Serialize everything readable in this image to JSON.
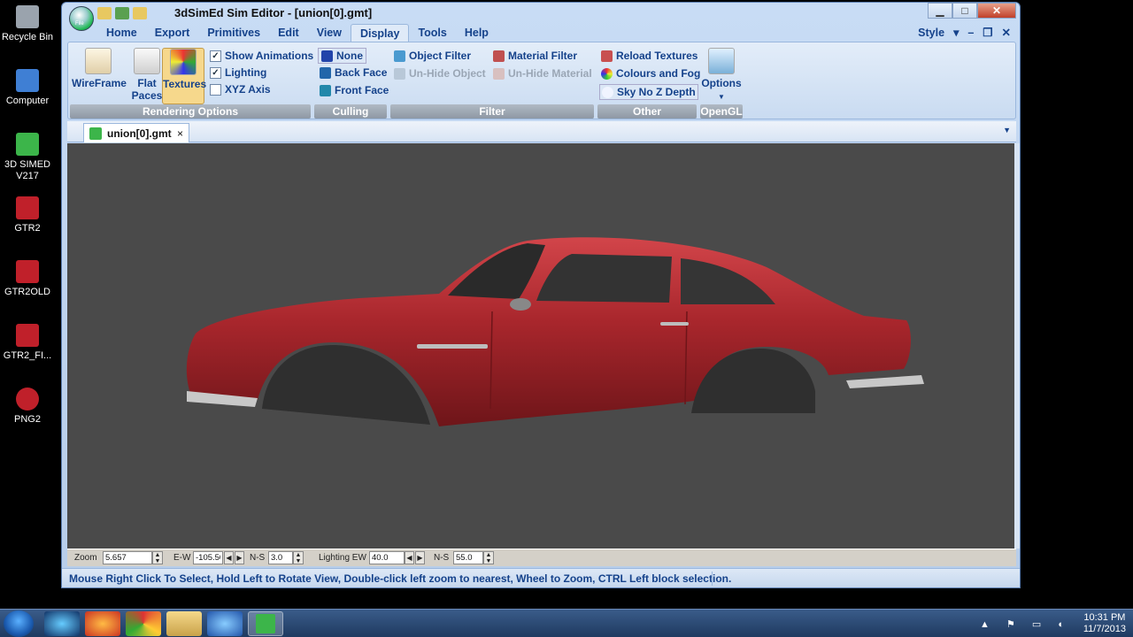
{
  "desktop": {
    "icons": [
      {
        "label": "Recycle Bin",
        "color": "#9aa3ad"
      },
      {
        "label": "Computer",
        "color": "#3f7fd4"
      },
      {
        "label": "3D SIMED V217",
        "color": "#3cb54a"
      },
      {
        "label": "GTR2",
        "color": "#c0202a"
      },
      {
        "label": "GTR2OLD",
        "color": "#c0202a"
      },
      {
        "label": "GTR2_FI...",
        "color": "#c0202a"
      },
      {
        "label": "PNG2",
        "color": "#c0202a"
      }
    ]
  },
  "window": {
    "title": "3dSimEd Sim Editor - [union[0].gmt]",
    "orb_label": "File",
    "controls": {
      "minimize": "▁",
      "maximize": "□",
      "close": "✕"
    }
  },
  "menu": {
    "items": [
      "Home",
      "Export",
      "Primitives",
      "Edit",
      "View",
      "Display",
      "Tools",
      "Help"
    ],
    "active": "Display",
    "style_label": "Style"
  },
  "ribbon": {
    "rendering": {
      "label": "Rendering Options",
      "wireframe": "WireFrame",
      "flat_faces_1": "Flat",
      "flat_faces_2": "Paces",
      "textures": "Textures",
      "show_animations": "Show Animations",
      "lighting": "Lighting",
      "xyz_axis": "XYZ Axis",
      "show_animations_checked": true,
      "lighting_checked": true,
      "xyz_axis_checked": false
    },
    "culling": {
      "label": "Culling",
      "none": "None",
      "back_face": "Back Face",
      "front_face": "Front Face"
    },
    "filter": {
      "label": "Filter",
      "object_filter": "Object Filter",
      "material_filter": "Material Filter",
      "unhide_object": "Un-Hide Object",
      "unhide_material": "Un-Hide Material"
    },
    "other": {
      "label": "Other",
      "reload_textures": "Reload Textures",
      "colours_fog": "Colours and Fog",
      "sky_no_z": "Sky No Z Depth"
    },
    "opengl": {
      "label": "OpenGL",
      "options": "Options"
    }
  },
  "document_tab": {
    "label": "union[0].gmt",
    "close": "×"
  },
  "controls": {
    "zoom_label": "Zoom",
    "zoom_value": "5.657",
    "ew_label": "E-W",
    "ew_value": "-105.50",
    "ns_label": "N-S",
    "ns_value": "3.0",
    "lighting_ew_label": "Lighting EW",
    "lighting_ew_value": "40.0",
    "lighting_ns_label": "N-S",
    "lighting_ns_value": "55.0"
  },
  "status": {
    "text": "Mouse Right Click To Select, Hold Left to Rotate View, Double-click left  zoom to nearest, Wheel to Zoom, CTRL Left block selection."
  },
  "taskbar": {
    "time": "10:31 PM",
    "date": "11/7/2013"
  },
  "colors": {
    "car_body": "#a8262c",
    "viewport_bg": "#4a4a4a"
  }
}
